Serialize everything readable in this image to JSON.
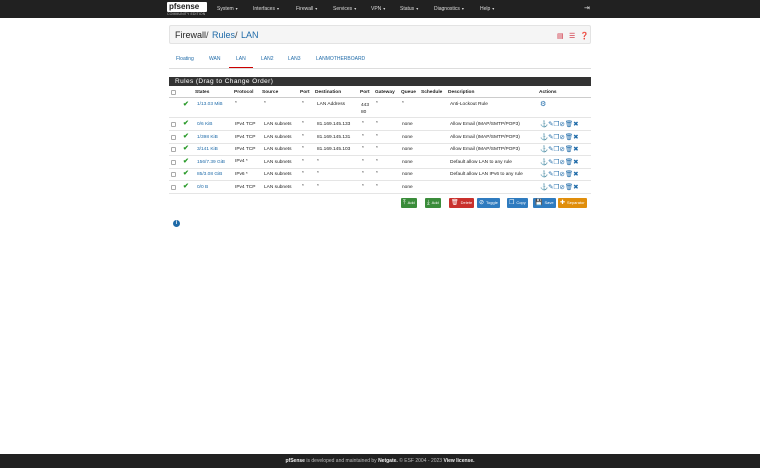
{
  "nav": {
    "logo_text": "pfsense",
    "edition": "COMMUNITY EDITION",
    "menu": [
      "System",
      "Interfaces",
      "Firewall",
      "Services",
      "VPN",
      "Status",
      "Diagnostics",
      "Help"
    ]
  },
  "breadcrumb": {
    "items": [
      "Firewall",
      "Rules",
      "LAN"
    ],
    "sep": "/"
  },
  "tabs": [
    "Floating",
    "WAN",
    "LAN",
    "LAN2",
    "LAN3",
    "LANMOTHERBOARD"
  ],
  "active_tab": "LAN",
  "panel_title": "Rules (Drag to Change Order)",
  "columns": [
    "States",
    "Protocol",
    "Source",
    "Port",
    "Destination",
    "Port",
    "Gateway",
    "Queue",
    "Schedule",
    "Description",
    "Actions"
  ],
  "rows": [
    {
      "states": "1/13.03 MiB",
      "protocol": "*",
      "source": "*",
      "sport": "*",
      "destination": "LAN Address",
      "dport": "443\n80",
      "gateway": "*",
      "queue": "*",
      "schedule": "",
      "description": "Anti-Lockout Rule"
    },
    {
      "states": "0/6 KiB",
      "protocol": "IPv4 TCP",
      "source": "LAN subnets",
      "sport": "*",
      "destination": "81.169.145.133",
      "dport": "*",
      "gateway": "*",
      "queue": "none",
      "schedule": "",
      "description": "Allow Email (IMAP/SMTP/POP3)"
    },
    {
      "states": "1/398 KiB",
      "protocol": "IPv4 TCP",
      "source": "LAN subnets",
      "sport": "*",
      "destination": "81.169.145.131",
      "dport": "*",
      "gateway": "*",
      "queue": "none",
      "schedule": "",
      "description": "Allow Email (IMAP/SMTP/POP3)"
    },
    {
      "states": "3/141 KiB",
      "protocol": "IPv4 TCP",
      "source": "LAN subnets",
      "sport": "*",
      "destination": "81.169.145.103",
      "dport": "*",
      "gateway": "*",
      "queue": "none",
      "schedule": "",
      "description": "Allow Email (IMAP/SMTP/POP3)"
    },
    {
      "states": "156/7.39 GiB",
      "protocol": "IPv4 *",
      "source": "LAN subnets",
      "sport": "*",
      "destination": "*",
      "dport": "*",
      "gateway": "*",
      "queue": "none",
      "schedule": "",
      "description": "Default allow LAN to any rule"
    },
    {
      "states": "85/3.08 GiB",
      "protocol": "IPv6 *",
      "source": "LAN subnets",
      "sport": "*",
      "destination": "*",
      "dport": "*",
      "gateway": "*",
      "queue": "none",
      "schedule": "",
      "description": "Default allow LAN IPv6 to any rule"
    },
    {
      "states": "0/0 B",
      "protocol": "IPv4 TCP",
      "source": "LAN subnets",
      "sport": "*",
      "destination": "*",
      "dport": "*",
      "gateway": "*",
      "queue": "none",
      "schedule": "",
      "description": ""
    }
  ],
  "buttons": {
    "add_top": "Add",
    "add_bottom": "Add",
    "delete": "Delete",
    "toggle": "Toggle",
    "copy": "Copy",
    "save": "Save",
    "separator": "Separator"
  },
  "footer": {
    "brand": "pfSense",
    "text1": " is developed and maintained by ",
    "company": "Netgate.",
    "text2": " © ESF 2004 - 2023 ",
    "license": "View license."
  },
  "colors": {
    "navbar": "#212121",
    "link": "#1e6aa8",
    "panel": "#333333",
    "add": "#3a8c3a",
    "delete": "#c9302c",
    "action": "#2f7bbf",
    "separator": "#e08e0b"
  }
}
